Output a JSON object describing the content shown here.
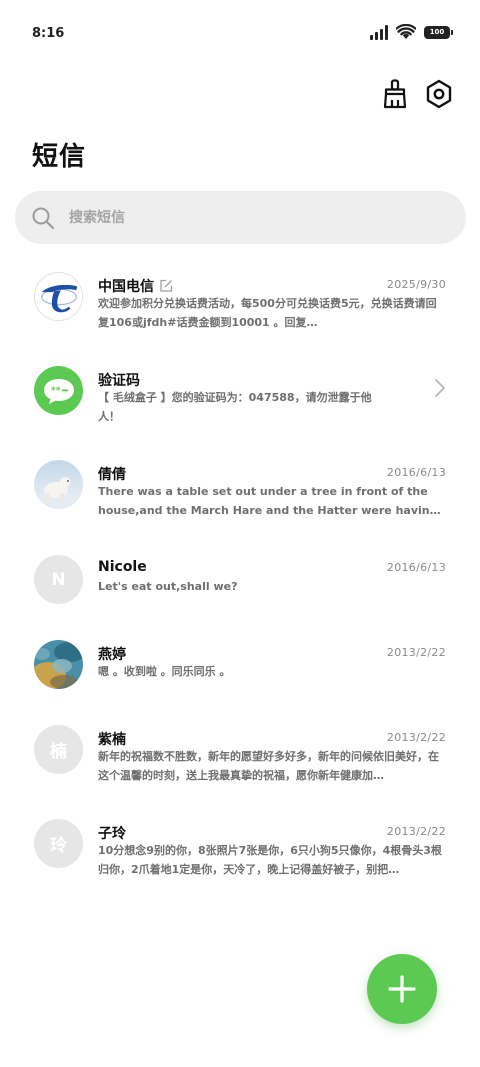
{
  "status_bar": {
    "time": "8:16",
    "battery": "100"
  },
  "header": {
    "title": "短信",
    "actions": [
      {
        "icon": "broom-icon",
        "label": "clean"
      },
      {
        "icon": "settings-hex-icon",
        "label": "settings"
      }
    ]
  },
  "search": {
    "placeholder": "搜索短信",
    "value": ""
  },
  "messages": [
    {
      "name": "中国电信",
      "date": "2025/9/30",
      "preview": "欢迎参加积分兑换话费活动，每500分可兑换话费5元，兑换话费请回复106或jfdh#话费金额到10001 。回复…",
      "avatar": "china-telecom-logo",
      "has_edit_icon": true
    },
    {
      "name": "验证码",
      "date": "",
      "preview": "【 毛绒盒子 】您的验证码为：047588，请勿泄露于他人！",
      "avatar": "verification-code-icon",
      "has_chevron": true
    },
    {
      "name": "倩倩",
      "date": "2016/6/13",
      "preview": "There was a table set out under a tree in front of the house,and the March Hare and the Hatter were having tea at it.",
      "avatar": "polar-bear-photo"
    },
    {
      "name": "Nicole",
      "date": "2016/6/13",
      "preview": "Let's eat out,shall we?",
      "avatar": "letter",
      "avatar_letter": "N"
    },
    {
      "name": "燕婷",
      "date": "2013/2/22",
      "preview": "嗯 。收到啦 。同乐同乐 。",
      "avatar": "painting-photo"
    },
    {
      "name": "紫楠",
      "date": "2013/2/22",
      "preview": "新年的祝福数不胜数，新年的愿望好多好多，新年的问候依旧美好，在这个温馨的时刻，送上我最真挚的祝福，愿你新年健康加…",
      "avatar": "letter",
      "avatar_letter": "楠"
    },
    {
      "name": "子玲",
      "date": "2013/2/22",
      "preview": "10分想念9别的你，8张照片7张是你，6只小狗5只像你，4根骨头3根归你，2爪着地1定是你，天冷了，晚上记得盖好被子，别把…",
      "avatar": "letter",
      "avatar_letter": "玲"
    }
  ],
  "colors": {
    "accent_green": "#5cc952",
    "telecom_blue": "#1f4fa8",
    "search_bg": "#eeeeee"
  },
  "fab": {
    "icon": "plus-icon",
    "label": "new-message"
  }
}
